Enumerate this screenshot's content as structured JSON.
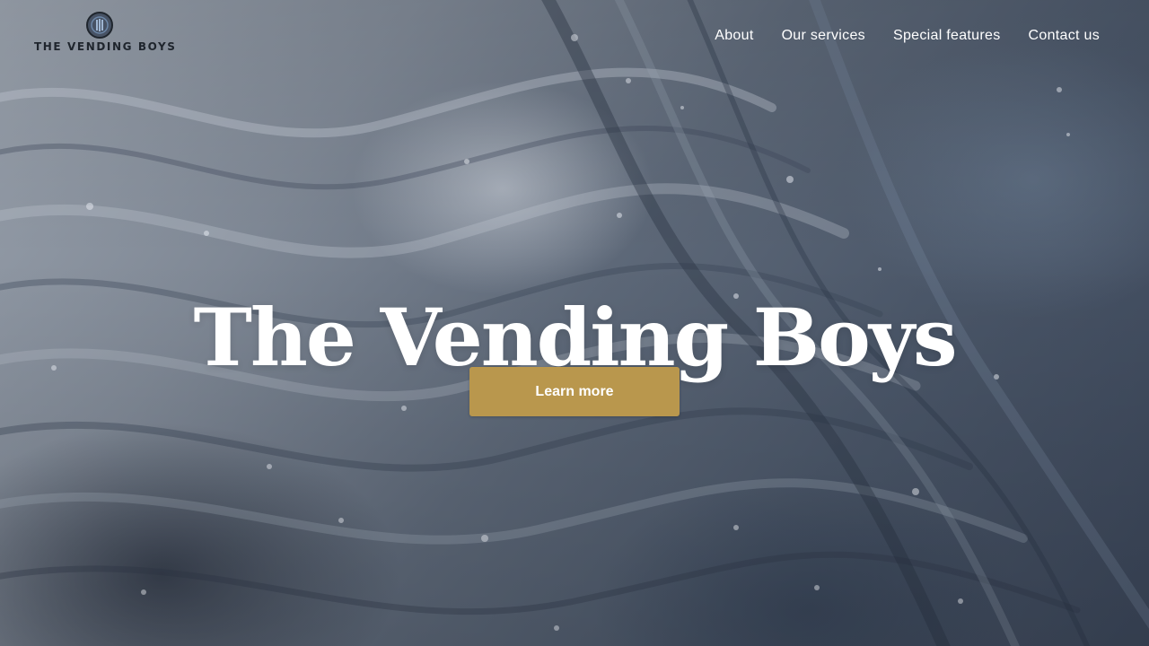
{
  "header": {
    "logo_text": "THE VENDING BOYS",
    "logo_icon": "vending-emblem-icon",
    "nav": [
      {
        "label": "About"
      },
      {
        "label": "Our services"
      },
      {
        "label": "Special features"
      },
      {
        "label": "Contact us"
      }
    ]
  },
  "hero": {
    "title": "The Vending Boys",
    "cta_label": "Learn more"
  },
  "colors": {
    "accent": "#b9974d",
    "nav_text": "#ffffff",
    "logo_text": "#1f252d"
  }
}
